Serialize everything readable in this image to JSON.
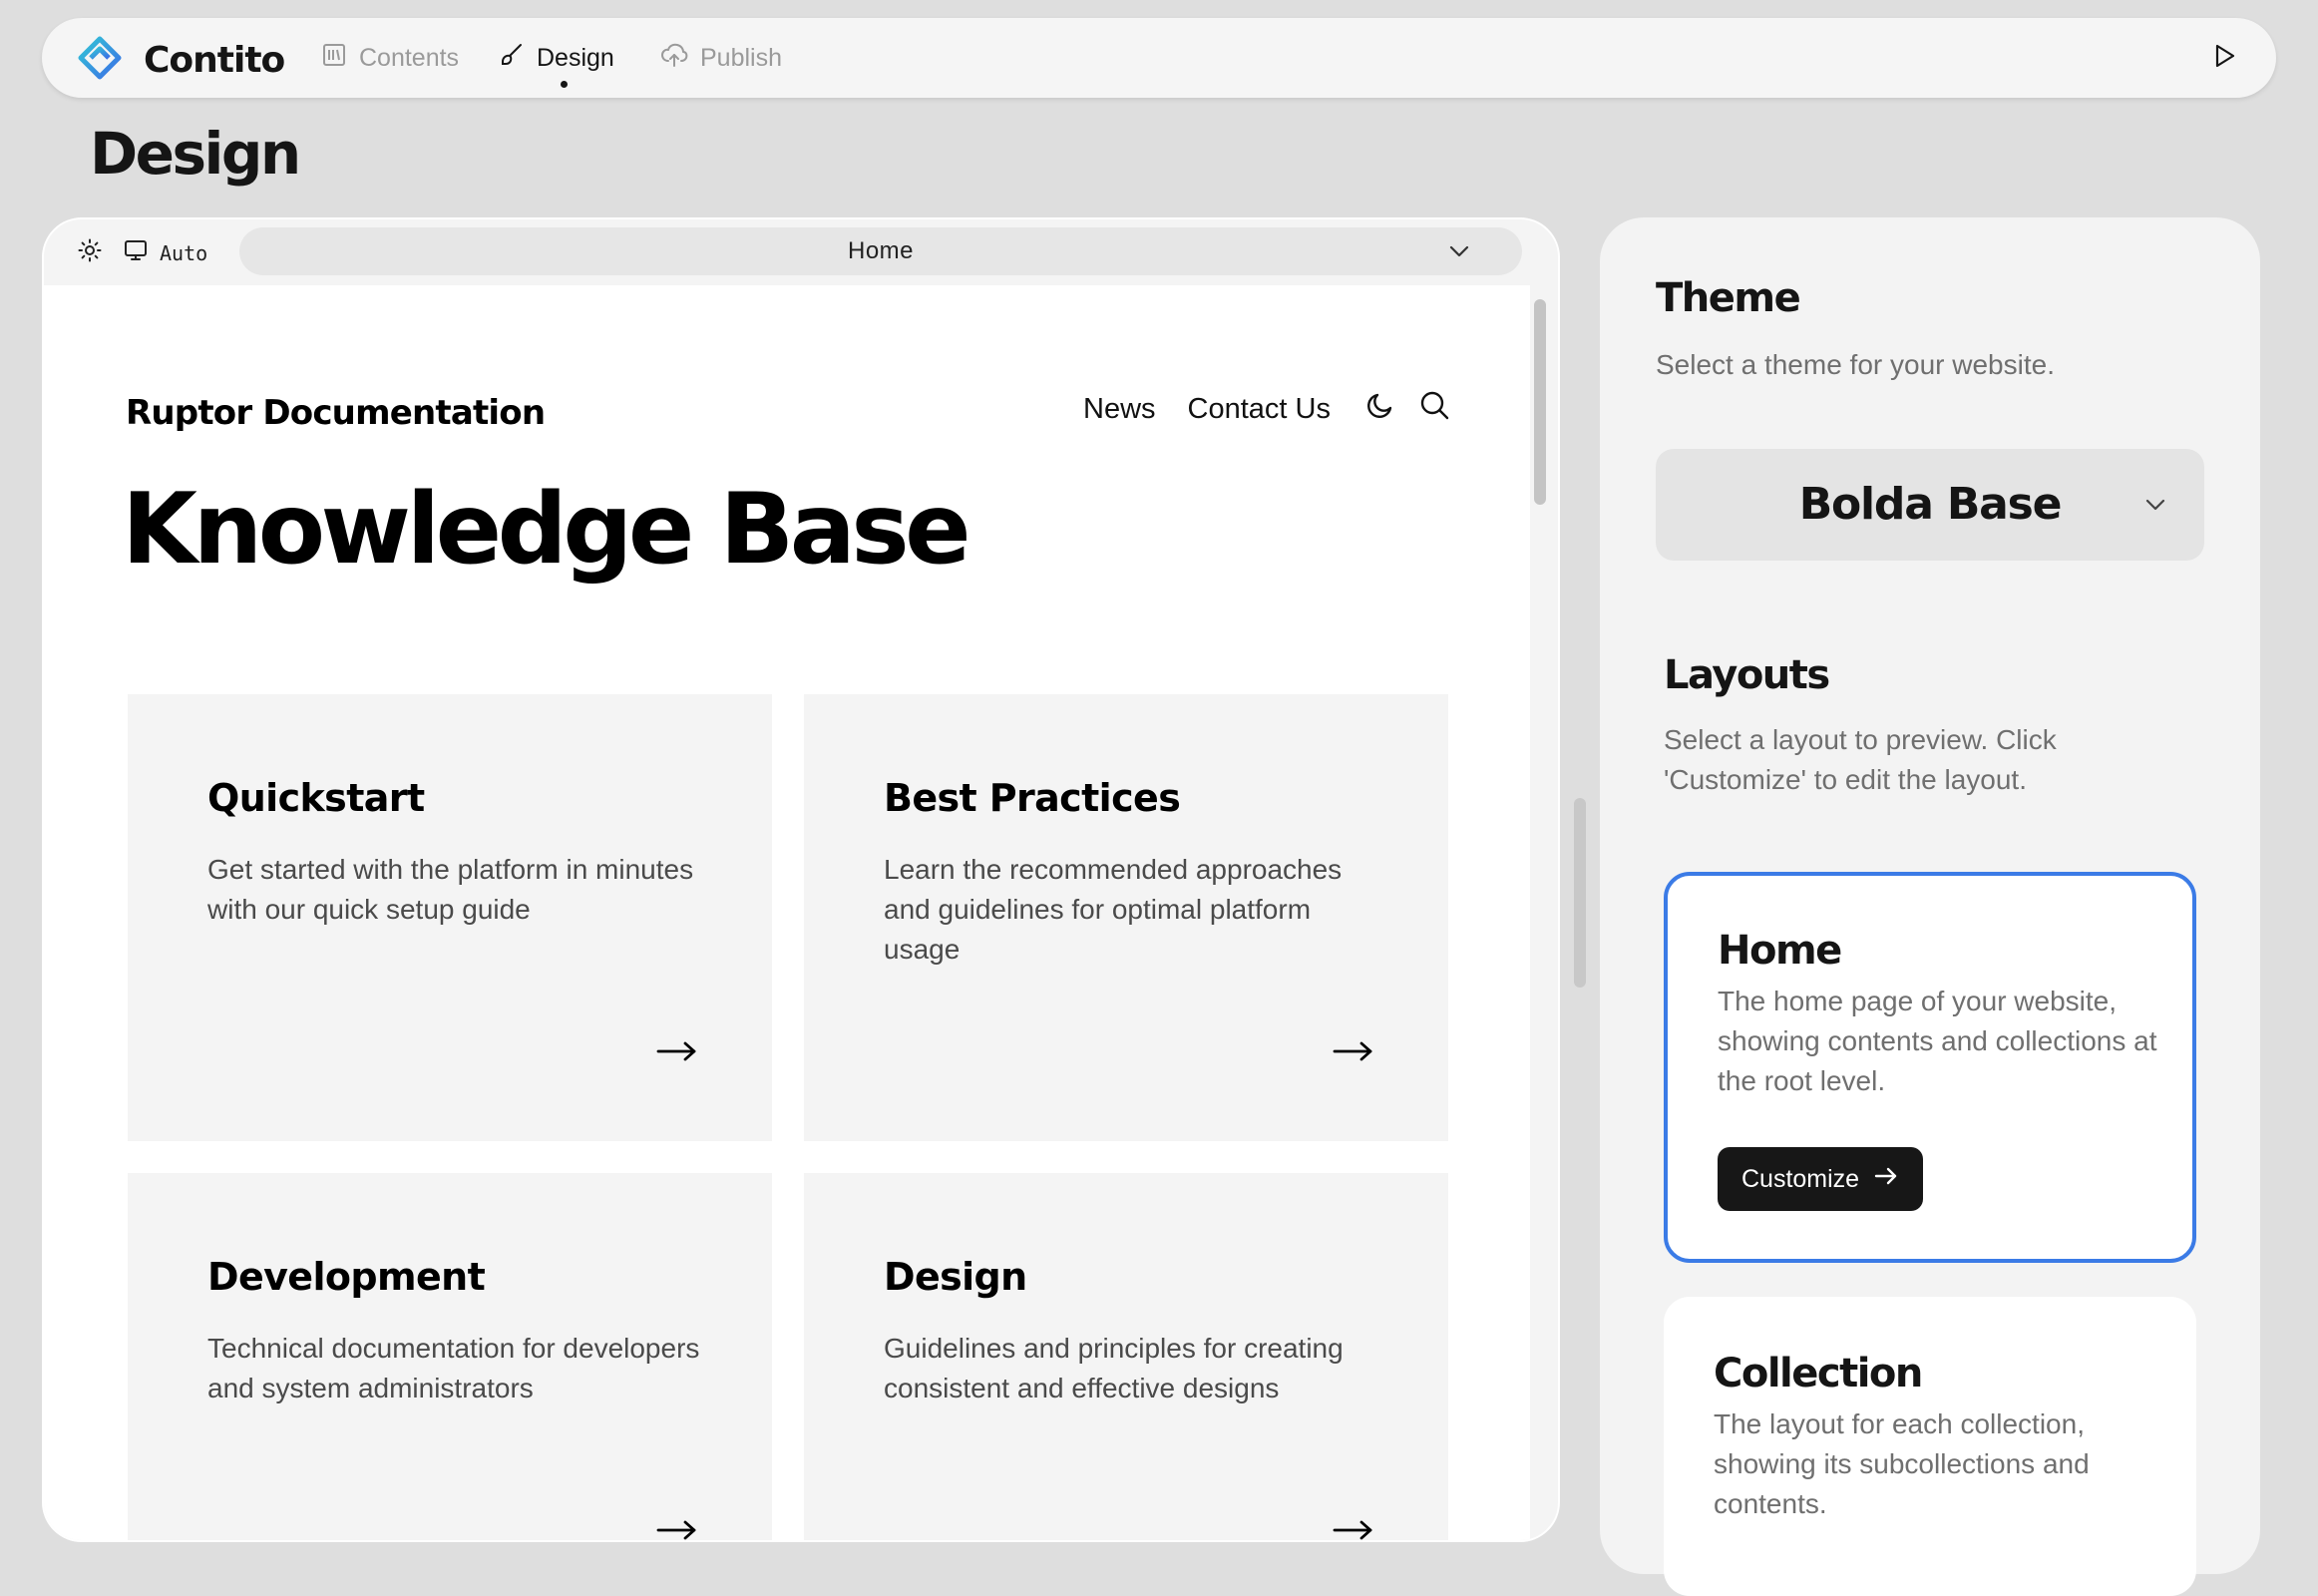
{
  "app": {
    "name": "Contito",
    "accent_color": "#3b7be6"
  },
  "nav": {
    "tabs": [
      {
        "label": "Contents",
        "icon": "library-icon",
        "active": false
      },
      {
        "label": "Design",
        "icon": "brush-icon",
        "active": true
      },
      {
        "label": "Publish",
        "icon": "cloud-upload-icon",
        "active": false
      }
    ]
  },
  "page": {
    "title": "Design"
  },
  "preview": {
    "mode_label": "Auto",
    "page_select": "Home",
    "site": {
      "name": "Ruptor Documentation",
      "nav_links": [
        "News",
        "Contact Us"
      ],
      "hero_title": "Knowledge Base",
      "cards": [
        {
          "title": "Quickstart",
          "description": "Get started with the platform in minutes with our quick setup guide"
        },
        {
          "title": "Best Practices",
          "description": "Learn the recommended approaches and guidelines for optimal platform usage"
        },
        {
          "title": "Development",
          "description": "Technical documentation for developers and system administrators"
        },
        {
          "title": "Design",
          "description": "Guidelines and principles for creating consistent and effective designs"
        }
      ]
    }
  },
  "sidebar": {
    "theme": {
      "title": "Theme",
      "description": "Select a theme for your website.",
      "selected": "Bolda Base"
    },
    "layouts": {
      "title": "Layouts",
      "description": "Select a layout to preview. Click 'Customize' to edit the layout.",
      "items": [
        {
          "title": "Home",
          "description": "The home page of your website, showing contents and collections at the root level.",
          "selected": true,
          "button_label": "Customize"
        },
        {
          "title": "Collection",
          "description": "The layout for each collection, showing its subcollections and contents.",
          "selected": false
        }
      ]
    }
  }
}
